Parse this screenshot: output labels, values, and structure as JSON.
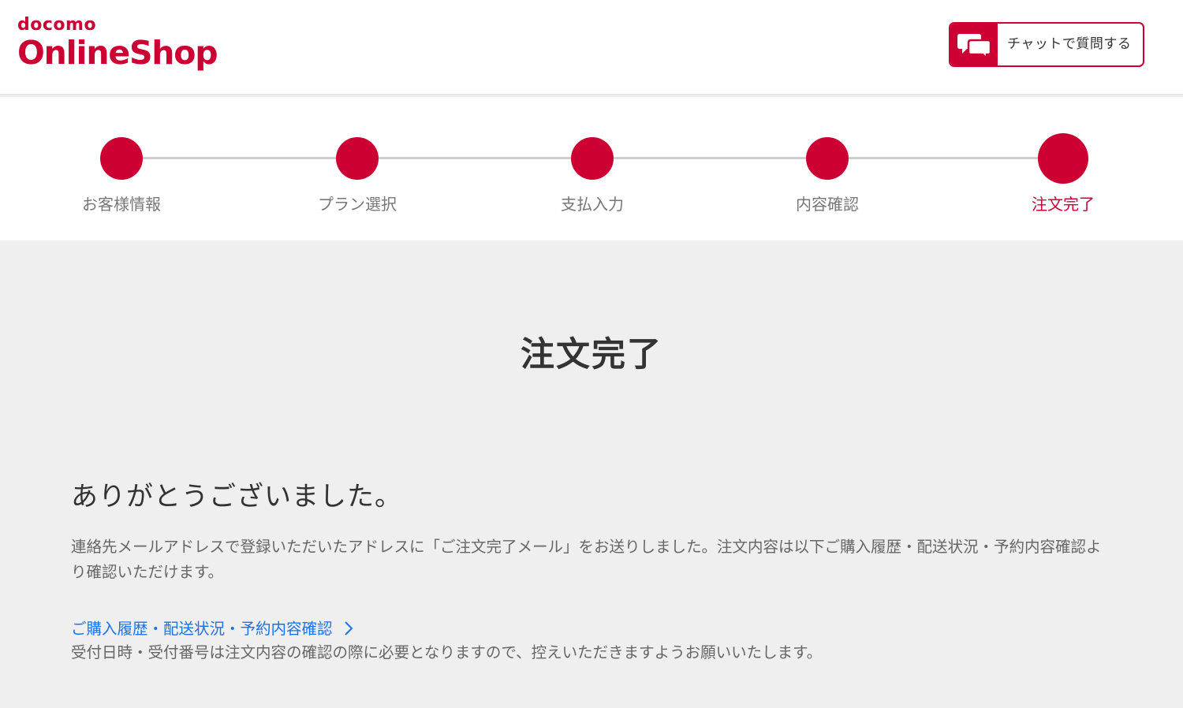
{
  "header": {
    "logo_top": "docomo",
    "logo_main": "OnlineShop",
    "chat_button_label": "チャットで質問する",
    "chat_icon": "chat-bubbles-icon"
  },
  "stepper": {
    "steps": [
      {
        "label": "お客様情報"
      },
      {
        "label": "プラン選択"
      },
      {
        "label": "支払入力"
      },
      {
        "label": "内容確認"
      },
      {
        "label": "注文完了"
      }
    ],
    "current_step": 5
  },
  "main": {
    "title": "注文完了",
    "thanks": "ありがとうございました。",
    "message": "連絡先メールアドレスで登録いただいたアドレスに「ご注文完了メール」をお送りしました。注文内容は以下ご購入履歴・配送状況・予約内容確認より確認いただけます。",
    "history_link": "ご購入履歴・配送状況・予約内容確認",
    "note": "受付日時・受付番号は注文内容の確認の際に必要となりますので、控えいただきますようお願いいたします。"
  },
  "colors": {
    "brand": "#cc0033",
    "link": "#1a73e8",
    "background": "#efefef"
  }
}
